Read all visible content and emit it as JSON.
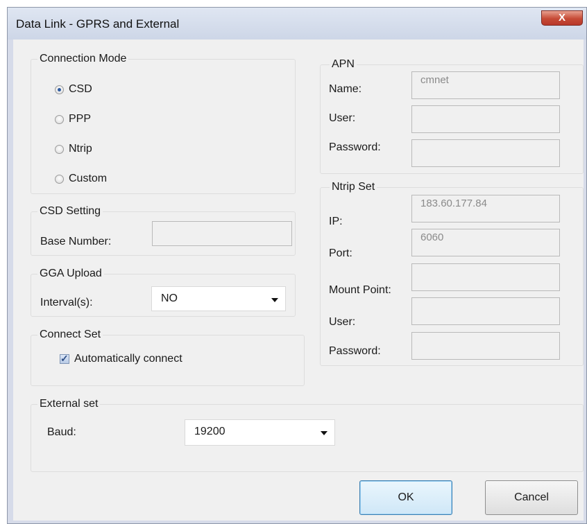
{
  "window": {
    "title": "Data Link - GPRS and External",
    "close_label": "X"
  },
  "connection_mode": {
    "legend": "Connection Mode",
    "options": [
      {
        "label": "CSD",
        "checked": true
      },
      {
        "label": "PPP",
        "checked": false
      },
      {
        "label": "Ntrip",
        "checked": false
      },
      {
        "label": "Custom",
        "checked": false
      }
    ]
  },
  "csd_setting": {
    "legend": "CSD Setting",
    "base_number_label": "Base Number:",
    "base_number_value": ""
  },
  "gga_upload": {
    "legend": "GGA Upload",
    "interval_label": "Interval(s):",
    "interval_value": "NO"
  },
  "connect_set": {
    "legend": "Connect Set",
    "auto_connect_label": "Automatically connect",
    "auto_connect_checked": true
  },
  "apn": {
    "legend": "APN",
    "name_label": "Name:",
    "name_value": "cmnet",
    "user_label": "User:",
    "user_value": "",
    "password_label": "Password:",
    "password_value": ""
  },
  "ntrip_set": {
    "legend": "Ntrip Set",
    "ip_label": "IP:",
    "ip_value": "183.60.177.84",
    "port_label": "Port:",
    "port_value": "6060",
    "mount_point_label": "Mount Point:",
    "mount_point_value": "",
    "user_label": "User:",
    "user_value": "",
    "password_label": "Password:",
    "password_value": ""
  },
  "external_set": {
    "legend": "External set",
    "baud_label": "Baud:",
    "baud_value": "19200"
  },
  "buttons": {
    "ok": "OK",
    "cancel": "Cancel"
  },
  "colors": {
    "title_bar": "#cdd6e7",
    "close_button": "#c64a36",
    "dialog_bg": "#f0f0f0",
    "default_button_border": "#3c7fb1"
  }
}
